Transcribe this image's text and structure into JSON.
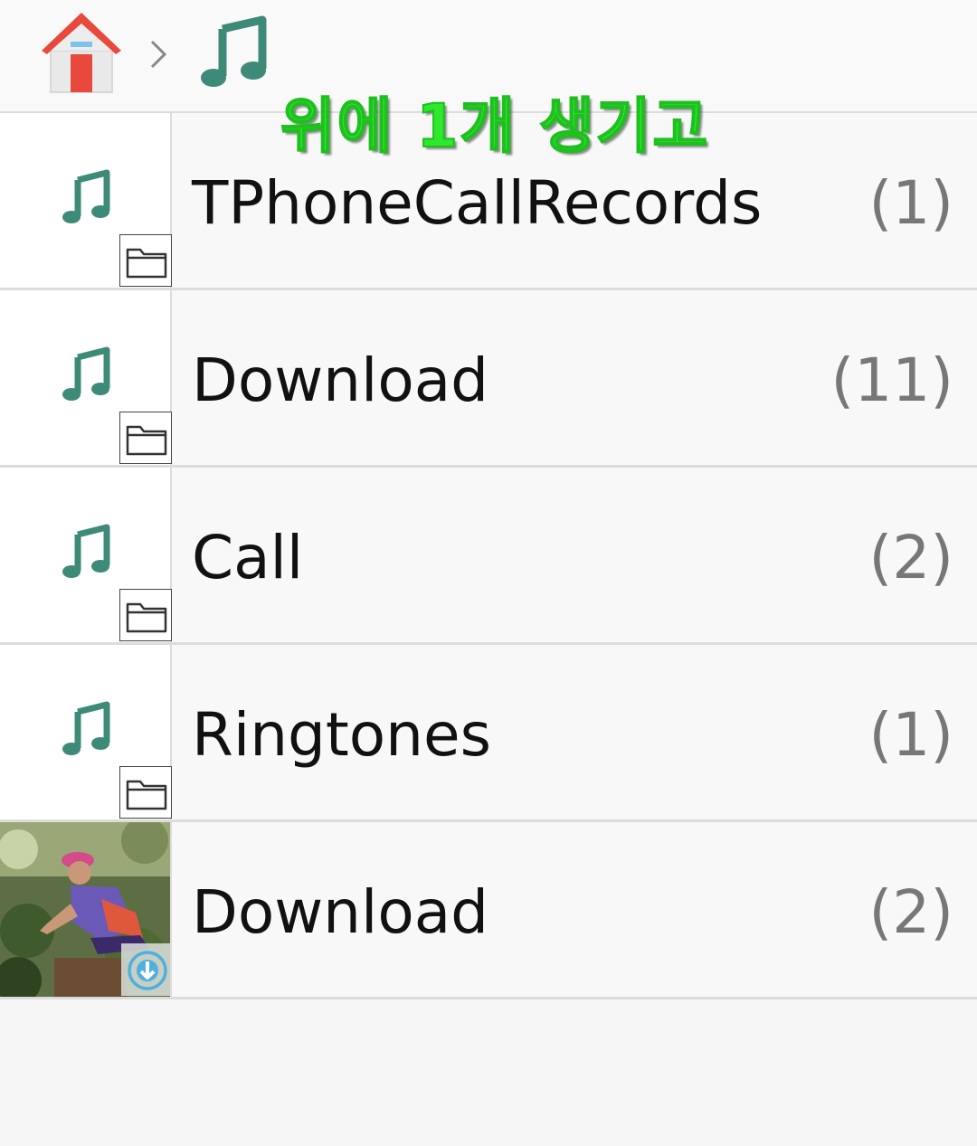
{
  "breadcrumb": {
    "home_icon": "home-icon",
    "separator_icon": "chevron-right-icon",
    "current_icon": "music-note-icon"
  },
  "annotation": {
    "text": "위에 1개 생기고",
    "color": "#2ee82e"
  },
  "colors": {
    "music_icon": "#3d8a78",
    "home_roof": "#e8493c",
    "count_text": "#777777"
  },
  "folders": [
    {
      "name": "TPhoneCallRecords",
      "count": "(1)",
      "thumb_icon": "music-note-icon",
      "badge_icon": "folder-icon"
    },
    {
      "name": "Download",
      "count": "(11)",
      "thumb_icon": "music-note-icon",
      "badge_icon": "folder-icon"
    },
    {
      "name": "Call",
      "count": "(2)",
      "thumb_icon": "music-note-icon",
      "badge_icon": "folder-icon"
    },
    {
      "name": "Ringtones",
      "count": "(1)",
      "thumb_icon": "music-note-icon",
      "badge_icon": "folder-icon"
    },
    {
      "name": "Download",
      "count": "(2)",
      "thumb_icon": "photo-thumbnail",
      "badge_icon": "download-icon"
    }
  ]
}
